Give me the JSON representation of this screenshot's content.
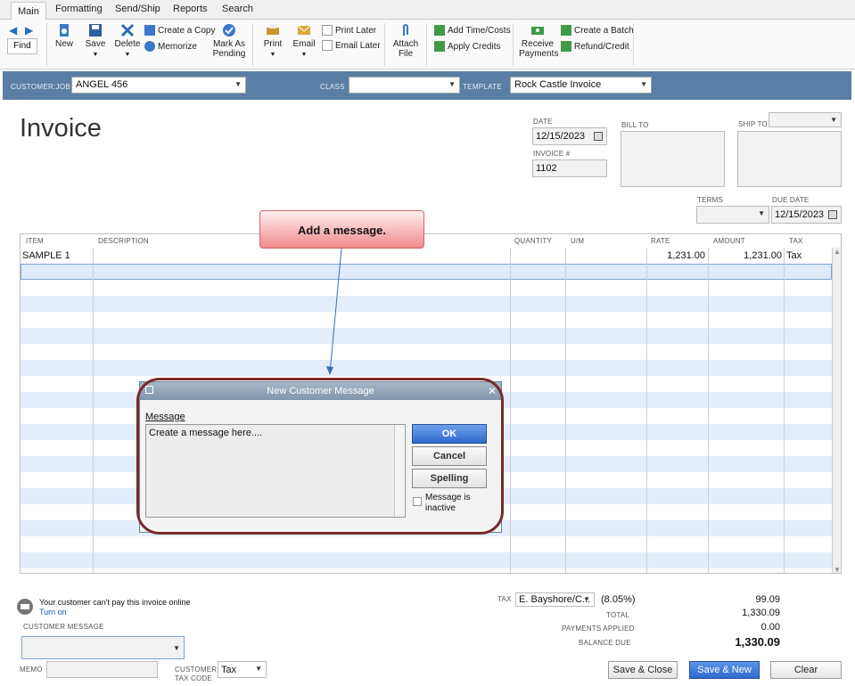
{
  "ribbon": {
    "tabs": [
      "Main",
      "Formatting",
      "Send/Ship",
      "Reports",
      "Search"
    ],
    "find": "Find",
    "new": "New",
    "save": "Save",
    "delete": "Delete",
    "create_copy": "Create a Copy",
    "memorize": "Memorize",
    "mark_as_pending_1": "Mark As",
    "mark_as_pending_2": "Pending",
    "print": "Print",
    "email": "Email",
    "print_later": "Print Later",
    "email_later": "Email Later",
    "attach_1": "Attach",
    "attach_2": "File",
    "add_time_costs": "Add Time/Costs",
    "apply_credits": "Apply Credits",
    "receive_payments_1": "Receive",
    "receive_payments_2": "Payments",
    "create_batch": "Create a Batch",
    "refund_credit": "Refund/Credit"
  },
  "header": {
    "customer_job_label": "CUSTOMER:JOB",
    "customer_job": "ANGEL 456",
    "class_label": "CLASS",
    "class_value": "",
    "template_label": "TEMPLATE",
    "template": "Rock Castle Invoice"
  },
  "form": {
    "title": "Invoice",
    "date_label": "DATE",
    "date": "12/15/2023",
    "invoice_no_label": "INVOICE #",
    "invoice_no": "1102",
    "bill_to_label": "BILL TO",
    "ship_to_label": "SHIP TO",
    "terms_label": "TERMS",
    "terms": "",
    "due_date_label": "DUE DATE",
    "due_date": "12/15/2023"
  },
  "grid": {
    "columns": [
      "ITEM",
      "DESCRIPTION",
      "QUANTITY",
      "U/M",
      "RATE",
      "AMOUNT",
      "TAX"
    ],
    "rows": [
      {
        "item": "SAMPLE 1",
        "description": "",
        "quantity": "",
        "um": "",
        "rate": "1,231.00",
        "amount": "1,231.00",
        "tax": "Tax"
      }
    ]
  },
  "callout": {
    "text": "Add a message."
  },
  "dialog": {
    "title": "New Customer Message",
    "message_label": "Message",
    "message_text": "Create a message here....",
    "ok": "OK",
    "cancel": "Cancel",
    "spelling": "Spelling",
    "inactive_1": "Message is",
    "inactive_2": "inactive"
  },
  "footer": {
    "online_notice": "Your customer can't pay this invoice online",
    "turn_on": "Turn on",
    "customer_message_label": "CUSTOMER MESSAGE",
    "memo_label": "MEMO",
    "tax_code_label_1": "CUSTOMER",
    "tax_code_label_2": "TAX CODE",
    "tax_code": "Tax",
    "tax_label": "TAX",
    "tax_item": "E. Bayshore/C...",
    "tax_rate": "(8.05%)",
    "tax_amount": "99.09",
    "total_label": "TOTAL",
    "total": "1,330.09",
    "payments_label": "PAYMENTS APPLIED",
    "payments": "0.00",
    "balance_label": "BALANCE DUE",
    "balance": "1,330.09",
    "save_close": "Save & Close",
    "save_new": "Save & New",
    "clear": "Clear"
  },
  "colors": {
    "header_bar": "#5b7fa4",
    "row_alt": "#e3edfb",
    "accent_button": "#2f6bd0"
  }
}
